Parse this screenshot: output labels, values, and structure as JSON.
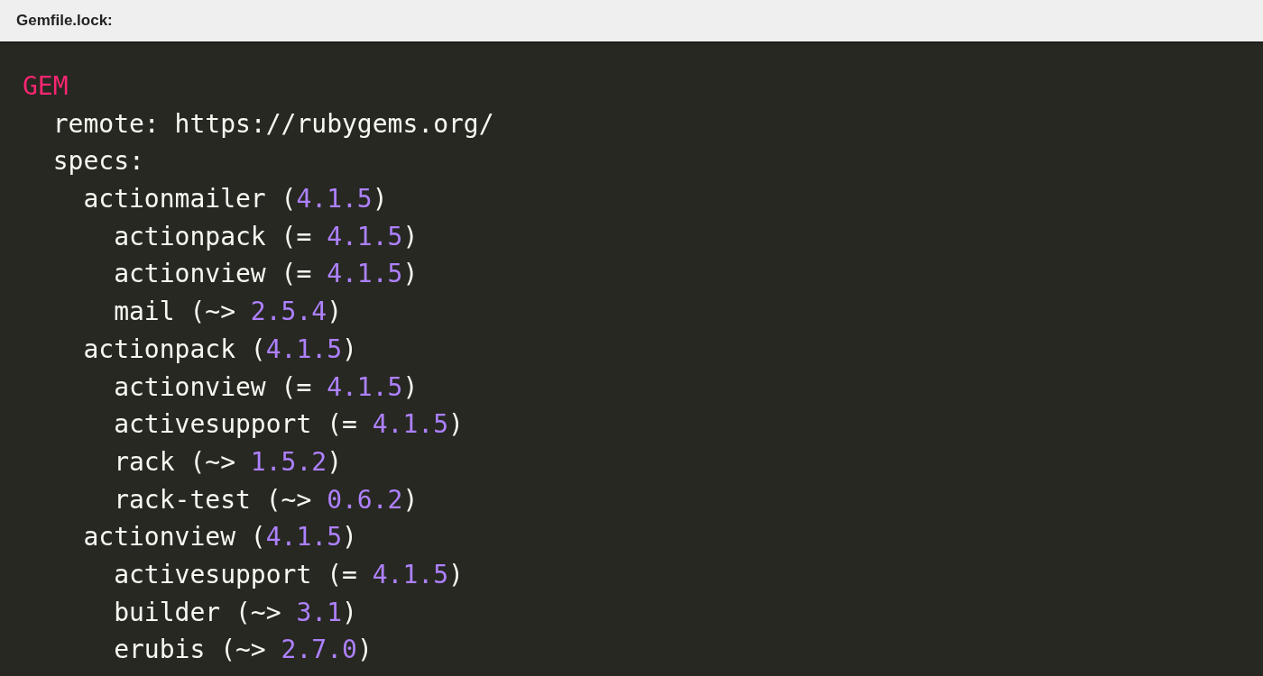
{
  "file_label": "Gemfile.lock:",
  "code": [
    {
      "kind": "section",
      "text": "GEM",
      "children": [
        {
          "kind": "plain",
          "text": "remote: https://rubygems.org/"
        },
        {
          "kind": "plain",
          "text": "specs:",
          "children": [
            {
              "kind": "gem",
              "text": "actionmailer (",
              "version": "4.1.5",
              "tail": ")",
              "children": [
                {
                  "kind": "gem",
                  "text": "actionpack (= ",
                  "version": "4.1.5",
                  "tail": ")"
                },
                {
                  "kind": "gem",
                  "text": "actionview (= ",
                  "version": "4.1.5",
                  "tail": ")"
                },
                {
                  "kind": "gem",
                  "text": "mail (~> ",
                  "version": "2.5.4",
                  "tail": ")"
                }
              ]
            },
            {
              "kind": "gem",
              "text": "actionpack (",
              "version": "4.1.5",
              "tail": ")",
              "children": [
                {
                  "kind": "gem",
                  "text": "actionview (= ",
                  "version": "4.1.5",
                  "tail": ")"
                },
                {
                  "kind": "gem",
                  "text": "activesupport (= ",
                  "version": "4.1.5",
                  "tail": ")"
                },
                {
                  "kind": "gem",
                  "text": "rack (~> ",
                  "version": "1.5.2",
                  "tail": ")"
                },
                {
                  "kind": "gem",
                  "text": "rack-test (~> ",
                  "version": "0.6.2",
                  "tail": ")"
                }
              ]
            },
            {
              "kind": "gem",
              "text": "actionview (",
              "version": "4.1.5",
              "tail": ")",
              "children": [
                {
                  "kind": "gem",
                  "text": "activesupport (= ",
                  "version": "4.1.5",
                  "tail": ")"
                },
                {
                  "kind": "gem",
                  "text": "builder (~> ",
                  "version": "3.1",
                  "tail": ")"
                },
                {
                  "kind": "gem",
                  "text": "erubis (~> ",
                  "version": "2.7.0",
                  "tail": ")"
                }
              ]
            }
          ]
        }
      ]
    }
  ]
}
